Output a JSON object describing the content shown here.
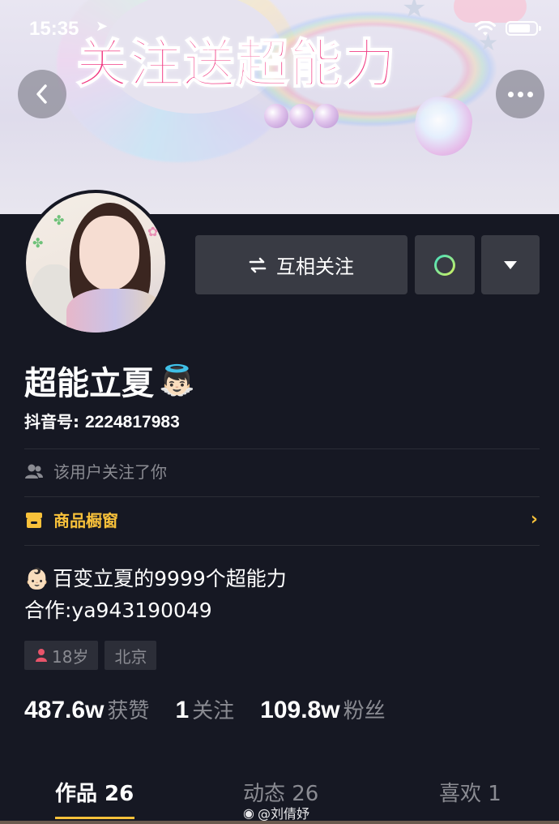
{
  "status_bar": {
    "time": "15:35"
  },
  "banner": {
    "title": "关注送超能力"
  },
  "actions": {
    "follow_label": "互相关注"
  },
  "profile": {
    "name": "超能立夏",
    "name_emoji": "👼🏻",
    "uid_label": "抖音号:",
    "uid_value": "2224817983",
    "follows_note": "该用户关注了你",
    "shop_label": "商品橱窗",
    "bio_line1_emoji": "👶🏻",
    "bio_line1": "百变立夏的9999个超能力",
    "bio_line2": "合作:ya943190049",
    "tags": {
      "age": "18岁",
      "city": "北京"
    }
  },
  "stats": {
    "likes_value": "487.6w",
    "likes_label": "获赞",
    "following_value": "1",
    "following_label": "关注",
    "followers_value": "109.8w",
    "followers_label": "粉丝"
  },
  "tabs": [
    {
      "label": "作品 26"
    },
    {
      "label": "动态 26"
    },
    {
      "label": "喜欢 1"
    }
  ],
  "watermark": "@刘倩妤",
  "colors": {
    "background": "#161823",
    "accent": "#f8c13a",
    "muted": "#8a8b92",
    "button": "#393b44",
    "banner_title": "#f0347f"
  }
}
